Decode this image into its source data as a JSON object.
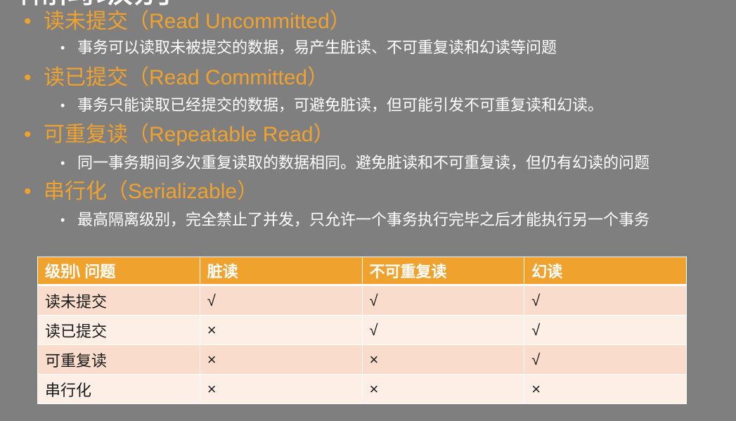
{
  "slide": {
    "title": "隔离级别",
    "bullets": [
      {
        "heading": "读未提交（Read Uncommitted）",
        "detail": "事务可以读取未被提交的数据，易产生脏读、不可重复读和幻读等问题"
      },
      {
        "heading": "读已提交（Read Committed）",
        "detail": "事务只能读取已经提交的数据，可避免脏读，但可能引发不可重复读和幻读。"
      },
      {
        "heading": "可重复读（Repeatable Read）",
        "detail": "同一事务期间多次重复读取的数据相同。避免脏读和不可重复读，但仍有幻读的问题"
      },
      {
        "heading": "串行化（Serializable）",
        "detail": "最高隔离级别，完全禁止了并发，只允许一个事务执行完毕之后才能执行另一个事务"
      }
    ]
  },
  "table": {
    "headers": [
      "级别\\ 问题",
      "脏读",
      "不可重复读",
      "幻读"
    ],
    "rows": [
      [
        "读未提交",
        "√",
        "√",
        "√"
      ],
      [
        "读已提交",
        "×",
        "√",
        "√"
      ],
      [
        "可重复读",
        "×",
        "×",
        "√"
      ],
      [
        "串行化",
        "×",
        "×",
        "×"
      ]
    ]
  },
  "colors": {
    "background": "#7f7f7f",
    "accent": "#f0a22e",
    "row_dark": "#f9dccb",
    "row_light": "#fdeee6"
  }
}
